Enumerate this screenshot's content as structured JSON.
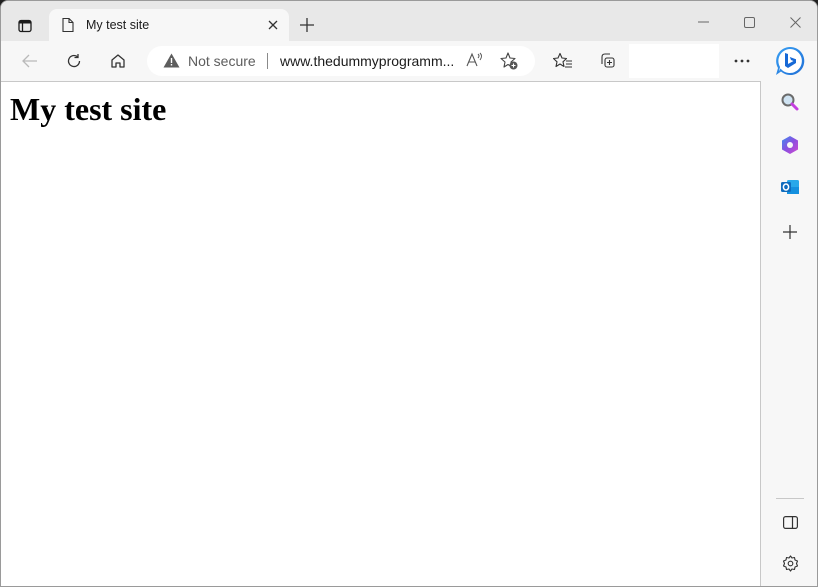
{
  "browser": {
    "tab": {
      "title": "My test site"
    },
    "address_bar": {
      "security_label": "Not secure",
      "url_display": "www.thedummyprogramm..."
    },
    "icons": {
      "tab_actions": "tab-actions-icon",
      "favicon": "page-icon",
      "tab_close": "close-icon",
      "new_tab": "plus-icon",
      "minimize": "minimize-icon",
      "maximize": "maximize-icon",
      "close_window": "close-icon",
      "back": "back-arrow-icon",
      "refresh": "refresh-icon",
      "home": "home-icon",
      "warning": "warning-icon",
      "read_aloud": "read-aloud-icon",
      "add_favorite": "add-favorite-icon",
      "favorites": "favorites-icon",
      "collections": "collections-icon",
      "more": "more-icon",
      "copilot": "bing-copilot-icon"
    },
    "colors": {
      "accent_blue": "#0f6cbd",
      "titlebar_bg": "#e8e8e8",
      "toolbar_bg": "#f7f7f7"
    }
  },
  "page": {
    "heading": "My test site"
  },
  "sidebar": {
    "items": [
      {
        "name": "search",
        "icon": "search-icon"
      },
      {
        "name": "microsoft-365",
        "icon": "office-icon"
      },
      {
        "name": "outlook",
        "icon": "outlook-icon"
      },
      {
        "name": "add",
        "icon": "plus-icon"
      }
    ],
    "bottom": [
      {
        "name": "hide-sidebar",
        "icon": "sidebar-toggle-icon"
      },
      {
        "name": "settings",
        "icon": "gear-icon"
      }
    ]
  }
}
